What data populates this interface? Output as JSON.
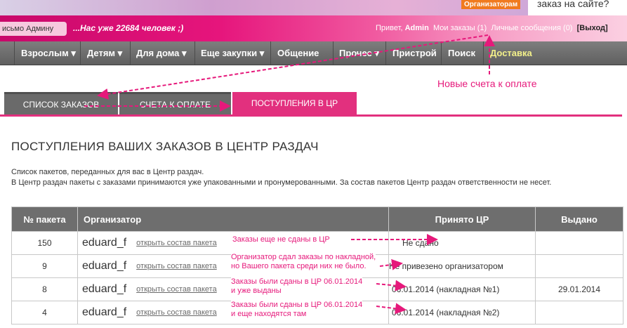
{
  "top": {
    "organizers_btn": "Организаторам",
    "question": "заказ на сайте?"
  },
  "header": {
    "letter_btn": "исьмо Админу",
    "slogan": "...Нас уже 22684 человек ;)",
    "greeting": "Привет,",
    "username": "Admin",
    "my_orders": "Мои заказы (1)",
    "messages": "Личные сообщения (0)",
    "logout": "[Выход]"
  },
  "nav": {
    "items": [
      {
        "label": "Взрослым ▾"
      },
      {
        "label": "Детям ▾"
      },
      {
        "label": "Для дома ▾"
      },
      {
        "label": "Еще закупки ▾"
      },
      {
        "label": "Общение"
      },
      {
        "label": "Прочее ▾"
      },
      {
        "label": "Пристрой"
      },
      {
        "label": "Поиск"
      },
      {
        "label": "Доставка"
      }
    ]
  },
  "tabs": {
    "orders": "Список заказов",
    "invoices": "Счета к оплате",
    "arrivals": "Поступления в ЦР"
  },
  "page": {
    "title": "ПОСТУПЛЕНИЯ ВАШИХ ЗАКАЗОВ В ЦЕНТР РАЗДАЧ",
    "desc1": "Список пакетов, переданных для вас в Центр раздач.",
    "desc2": "В Центр раздач пакеты с заказами принимаются уже упакованными и пронумерованными. За состав пакетов Центр раздач ответственности не несет."
  },
  "table": {
    "headers": {
      "num": "№ пакета",
      "org": "Организатор",
      "received": "Принято ЦР",
      "issued": "Выдано"
    },
    "rows": [
      {
        "num": "150",
        "org": "eduard_f",
        "link": "открыть состав пакета",
        "received": "Не сдано",
        "issued": ""
      },
      {
        "num": "9",
        "org": "eduard_f",
        "link": "открыть состав пакета",
        "received": "Не привезено организатором",
        "issued": ""
      },
      {
        "num": "8",
        "org": "eduard_f",
        "link": "открыть состав пакета",
        "received": "06.01.2014 (накладная №1)",
        "issued": "29.01.2014"
      },
      {
        "num": "4",
        "org": "eduard_f",
        "link": "открыть состав пакета",
        "received": "06.01.2014 (накладная №2)",
        "issued": ""
      }
    ]
  },
  "annotations": {
    "new_invoices": "Новые счета к оплате",
    "row1": "Заказы еще не сданы в ЦР",
    "row2_l1": "Организатор сдал заказы по накладной,",
    "row2_l2": "но Вашего пакета среди них не было.",
    "row3_l1": "Заказы были сданы в ЦР 06.01.2014",
    "row3_l2": "и уже выданы",
    "row4_l1": "Заказы были сданы в ЦР 06.01.2014",
    "row4_l2": "и еще находятся там"
  },
  "colors": {
    "accent": "#e2307e",
    "annotation": "#e6197b",
    "nav": "#6e6e6e",
    "delivery": "#f3f08a"
  }
}
